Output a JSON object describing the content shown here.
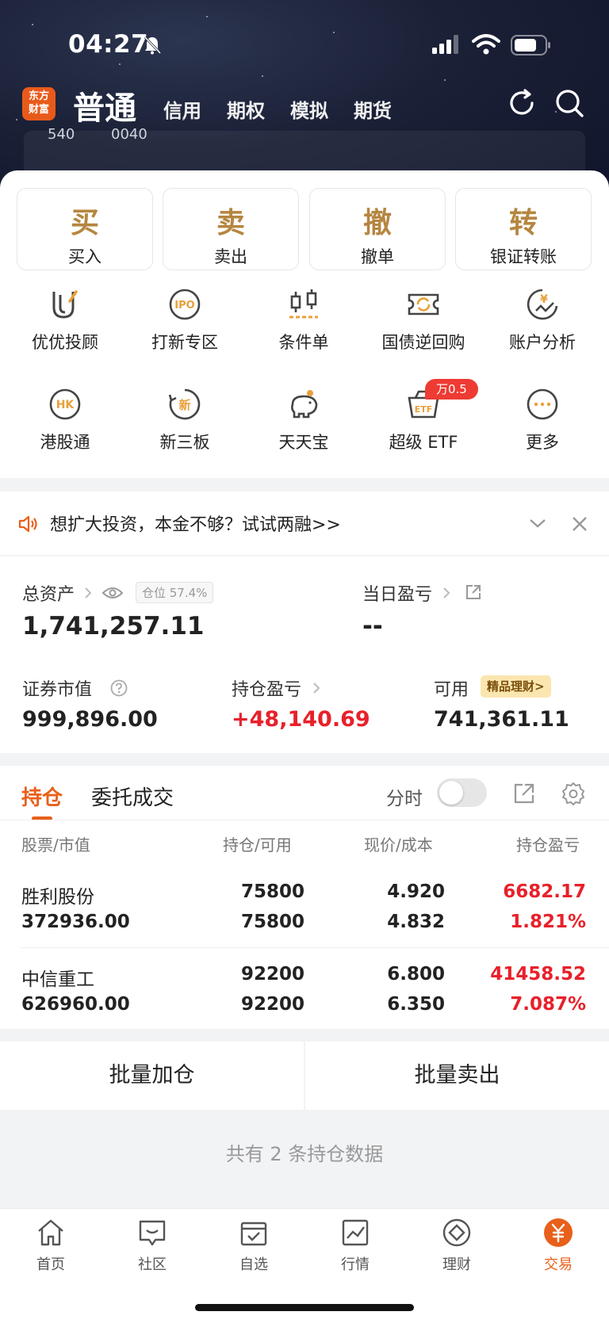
{
  "status": {
    "time": "04:27"
  },
  "header": {
    "logo_line1": "东方",
    "logo_line2": "财富",
    "title": "普通",
    "tabs": [
      "信用",
      "期权",
      "模拟",
      "期货"
    ]
  },
  "hero_preview": {
    "left": "540",
    "right": "0040"
  },
  "quick_actions": [
    {
      "glyph": "买",
      "label": "买入"
    },
    {
      "glyph": "卖",
      "label": "卖出"
    },
    {
      "glyph": "撤",
      "label": "撤单"
    },
    {
      "glyph": "转",
      "label": "银证转账"
    }
  ],
  "features": [
    {
      "label": "优优投顾",
      "icon": "uu-advisor-icon"
    },
    {
      "label": "打新专区",
      "icon": "ipo-icon",
      "icon_text": "IPO"
    },
    {
      "label": "条件单",
      "icon": "candlestick-icon"
    },
    {
      "label": "国债逆回购",
      "icon": "bond-repo-icon"
    },
    {
      "label": "账户分析",
      "icon": "account-analysis-icon",
      "icon_text": "¥"
    },
    {
      "label": "港股通",
      "icon": "hk-connect-icon",
      "icon_text": "HK"
    },
    {
      "label": "新三板",
      "icon": "neeq-icon",
      "icon_text": "新"
    },
    {
      "label": "天天宝",
      "icon": "piggy-bank-icon"
    },
    {
      "label": "超级 ETF",
      "icon": "etf-icon",
      "icon_text": "ETF"
    },
    {
      "label": "更多",
      "icon": "more-icon"
    }
  ],
  "etf_badge": "万0.5",
  "banner": {
    "text": "想扩大投资，本金不够？试试两融>>"
  },
  "assets": {
    "total_label": "总资产",
    "position_pill": "仓位 57.4%",
    "total_value": "1,741,257.11",
    "daily_pnl_label": "当日盈亏",
    "daily_pnl_value": "--",
    "market_value_label": "证券市值",
    "market_value": "999,896.00",
    "holding_pnl_label": "持仓盈亏",
    "holding_pnl": "+48,140.69",
    "available_label": "可用",
    "available_tag": "精品理财>",
    "available_value": "741,361.11"
  },
  "positions": {
    "tab_active": "持仓",
    "tab_other": "委托成交",
    "intraday_label": "分时",
    "intraday_on": false,
    "headers": [
      "股票/市值",
      "持仓/可用",
      "现价/成本",
      "持仓盈亏"
    ],
    "rows": [
      {
        "name": "胜利股份",
        "market_value": "372936.00",
        "holding": "75800",
        "available": "75800",
        "price": "4.920",
        "cost": "4.832",
        "pnl": "6682.17",
        "pnl_pct": "1.821%"
      },
      {
        "name": "中信重工",
        "market_value": "626960.00",
        "holding": "92200",
        "available": "92200",
        "price": "6.800",
        "cost": "6.350",
        "pnl": "41458.52",
        "pnl_pct": "7.087%"
      }
    ]
  },
  "actions": {
    "batch_add": "批量加仓",
    "batch_sell": "批量卖出"
  },
  "summary": "共有 2 条持仓数据",
  "tabbar": [
    {
      "label": "首页",
      "icon": "home-icon"
    },
    {
      "label": "社区",
      "icon": "community-icon"
    },
    {
      "label": "自选",
      "icon": "watchlist-icon"
    },
    {
      "label": "行情",
      "icon": "market-icon"
    },
    {
      "label": "理财",
      "icon": "wealth-icon"
    },
    {
      "label": "交易",
      "icon": "trade-icon",
      "active": true
    }
  ],
  "colors": {
    "accent": "#e8601a",
    "gain": "#e8202a",
    "gold": "#b58640"
  }
}
